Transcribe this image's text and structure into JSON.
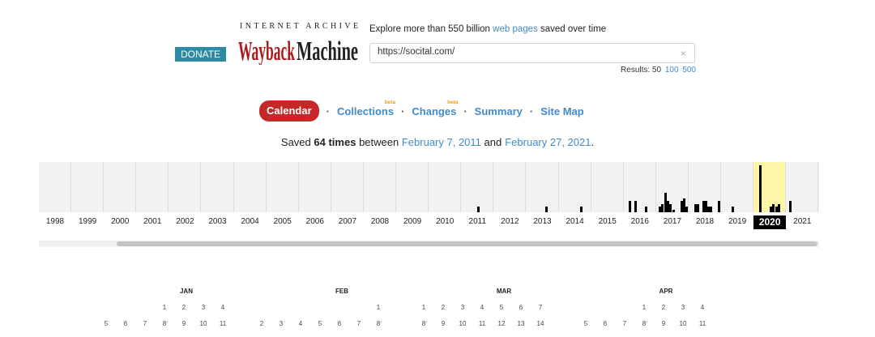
{
  "header": {
    "donate_label": "DONATE",
    "logo_top": "INTERNET ARCHIVE",
    "logo_main": "WaybackMachine",
    "explore_prefix": "Explore more than 550 billion",
    "explore_link": "web pages",
    "explore_suffix": "saved over time",
    "url_value": "https://socital.com/",
    "clear_icon": "×",
    "results_label": "Results: 50",
    "results_100": "100",
    "results_500": "500"
  },
  "tabs": {
    "calendar": "Calendar",
    "collections": "Collections",
    "changes": "Changes",
    "summary": "Summary",
    "sitemap": "Site Map",
    "beta": "beta",
    "separator": "·"
  },
  "saved": {
    "prefix": "Saved",
    "count": "64 times",
    "middle": "between",
    "start": "February 7, 2011",
    "and": "and",
    "end": "February 27, 2021",
    "period": "."
  },
  "timeline": {
    "years": [
      "1998",
      "1999",
      "2000",
      "2001",
      "2002",
      "2003",
      "2004",
      "2005",
      "2006",
      "2007",
      "2008",
      "2009",
      "2010",
      "2011",
      "2012",
      "2013",
      "2014",
      "2015",
      "2016",
      "2017",
      "2018",
      "2019",
      "2020",
      "2021"
    ],
    "selected_year": "2020",
    "captures": {
      "2011": [
        0,
        0,
        0,
        0,
        0,
        0,
        2,
        0,
        0,
        0,
        0,
        0
      ],
      "2013": [
        0,
        0,
        0,
        0,
        0,
        0,
        0,
        2,
        0,
        0,
        0,
        0
      ],
      "2014": [
        0,
        0,
        0,
        0,
        0,
        0,
        0,
        0,
        2,
        0,
        0,
        0
      ],
      "2016": [
        0,
        0,
        4,
        0,
        4,
        0,
        0,
        0,
        2,
        0,
        0,
        0
      ],
      "2017": [
        0,
        2,
        3,
        7,
        4,
        3,
        1,
        0,
        0,
        4,
        5,
        2
      ],
      "2018": [
        0,
        0,
        3,
        3,
        0,
        4,
        4,
        2,
        2,
        0,
        0,
        4
      ],
      "2019": [
        0,
        0,
        0,
        0,
        2,
        0,
        0,
        0,
        0,
        0,
        0,
        0
      ],
      "2020": [
        0,
        0,
        17,
        0,
        0,
        0,
        2,
        3,
        2,
        3,
        0,
        0
      ],
      "2021": [
        0,
        4,
        0,
        0,
        0,
        0,
        0,
        0,
        0,
        0,
        0,
        0
      ]
    }
  },
  "calendar": {
    "months": [
      {
        "name": "JAN",
        "weeks": [
          [
            "",
            "",
            "",
            "1",
            "2",
            "3",
            "4"
          ],
          [
            "5",
            "6",
            "7",
            "8",
            "9",
            "10",
            "11"
          ]
        ]
      },
      {
        "name": "FEB",
        "weeks": [
          [
            "",
            "",
            "",
            "",
            "",
            "",
            "1"
          ],
          [
            "2",
            "3",
            "4",
            "5",
            "6",
            "7",
            "8"
          ]
        ]
      },
      {
        "name": "MAR",
        "weeks": [
          [
            "1",
            "2",
            "3",
            "4",
            "5",
            "6",
            "7"
          ],
          [
            "8",
            "9",
            "10",
            "11",
            "12",
            "13",
            "14"
          ]
        ]
      },
      {
        "name": "APR",
        "weeks": [
          [
            "",
            "",
            "",
            "1",
            "2",
            "3",
            "4"
          ],
          [
            "5",
            "6",
            "7",
            "8",
            "9",
            "10",
            "11"
          ]
        ]
      }
    ]
  }
}
